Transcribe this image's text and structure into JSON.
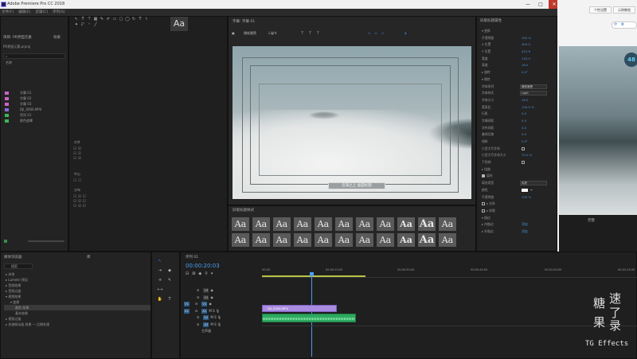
{
  "app": {
    "title": "Adobe Premiere Pro CC 2018",
    "minimize": "—",
    "maximize": "□",
    "close": "✕"
  },
  "menu": [
    "文件(F)",
    "编辑(E)",
    "剪辑(C)",
    "序列(S)"
  ],
  "source_tools": {
    "label": "Aa"
  },
  "project": {
    "tab": "项目: PR界面元素",
    "tab2": "效果",
    "file": "PR界面元素.prproj",
    "col_name": "名称",
    "items": [
      {
        "name": "字幕 01",
        "color": "#c864c8"
      },
      {
        "name": "字幕 02",
        "color": "#c864c8"
      },
      {
        "name": "字幕 03",
        "color": "#c864c8"
      },
      {
        "name": "DJI_0006.MP4",
        "color": "#8a6ad8"
      },
      {
        "name": "序列 01",
        "color": "#3ab85a"
      },
      {
        "name": "颜色遮罩",
        "color": "#3ab85a"
      }
    ]
  },
  "legacy": {
    "tab": "字幕: 字幕 01",
    "font": "微软雅黑",
    "style": "Light",
    "caption": "云海之上 画面标题"
  },
  "styles": {
    "tab": "旧版标题样式",
    "labels": [
      "Aa",
      "Aa",
      "Aa",
      "Aa",
      "Aa",
      "Aa",
      "Aa",
      "Aa",
      "Aa",
      "Aa",
      "Aa",
      "Aa",
      "Aa",
      "Aa",
      "Aa",
      "Aa",
      "Aa",
      "Aa",
      "Aa",
      "Aa",
      "Aa",
      "Aa"
    ]
  },
  "props": {
    "tab": "旧版标题属性",
    "rows": [
      {
        "label": "▾ 变换",
        "value": ""
      },
      {
        "label": "不透明度",
        "value": "100 %"
      },
      {
        "label": "X 位置",
        "value": "400.0"
      },
      {
        "label": "Y 位置",
        "value": "422.6"
      },
      {
        "label": "宽度",
        "value": "120.0"
      },
      {
        "label": "高度",
        "value": "18.0"
      },
      {
        "label": "▸ 旋转",
        "value": "0.0°"
      },
      {
        "label": "▾ 属性",
        "value": ""
      },
      {
        "label": "字体系列",
        "field": "微软雅黑"
      },
      {
        "label": "字体样式",
        "field": "Light"
      },
      {
        "label": "字体大小",
        "value": "18.0"
      },
      {
        "label": "宽高比",
        "value": "100.0 %"
      },
      {
        "label": "行距",
        "value": "0.0"
      },
      {
        "label": "字偶间距",
        "value": "0.0"
      },
      {
        "label": "字符间距",
        "value": "0.0"
      },
      {
        "label": "基线位移",
        "value": "0.0"
      },
      {
        "label": "倾斜",
        "value": "0.0°"
      },
      {
        "label": "小型大写字母",
        "value": "",
        "check": true
      },
      {
        "label": "小型大写字母大小",
        "value": "75.0 %"
      },
      {
        "label": "下划线",
        "value": "",
        "check": true
      },
      {
        "label": "▸ 扭曲",
        "value": ""
      },
      {
        "label": "填充",
        "value": "",
        "check": true,
        "on": true
      },
      {
        "label": "填充类型",
        "field": "实底"
      },
      {
        "label": "颜色",
        "value": ""
      },
      {
        "label": "不透明度",
        "value": "100 %"
      },
      {
        "label": "▸ 光泽",
        "value": "",
        "check": true
      },
      {
        "label": "▸ 纹理",
        "value": "",
        "check": true
      },
      {
        "label": "▾ 描边",
        "value": ""
      },
      {
        "label": "▸ 内描边",
        "value": "添加"
      },
      {
        "label": "▸ 外描边",
        "value": "添加"
      }
    ]
  },
  "right_strip": {
    "badge": "48",
    "btn1": "个性设置",
    "btn2": "示例教程",
    "dropdown": "完整"
  },
  "source_panel": {
    "label1": "对齐",
    "label2": "中心",
    "label3": "分布"
  },
  "bin": {
    "tab": "媒体浏览器",
    "tab2": "库",
    "search": "搜索",
    "items": [
      "本地",
      "Lumetri 预设",
      "音频效果",
      "音频过渡",
      "视频效果",
      "变换",
      "裁剪 效果",
      "基本效果",
      "视频过渡",
      "关键帧动画 效果 — 后期处理"
    ]
  },
  "timeline": {
    "tab": "序列 01",
    "timecode": "00:00:20:03",
    "ruler": [
      "00:00",
      "00:00:15:00",
      "00:00:30:00",
      "00:00:45:00",
      "00:01:00:00",
      "00:01:15:00"
    ],
    "tracks": [
      "V3",
      "V2",
      "V1",
      "A1",
      "A2",
      "A3",
      "主声道"
    ],
    "clip": "DJI_0006.MP4"
  },
  "watermark": {
    "chars": [
      "糖",
      "果",
      "速",
      "了",
      "录"
    ],
    "brand": "TG Effects"
  },
  "colors": {
    "accent": "#2d8ceb",
    "clip_video": "#a98be0",
    "clip_audio": "#2ea860",
    "timecode": "#4a9ef5"
  }
}
